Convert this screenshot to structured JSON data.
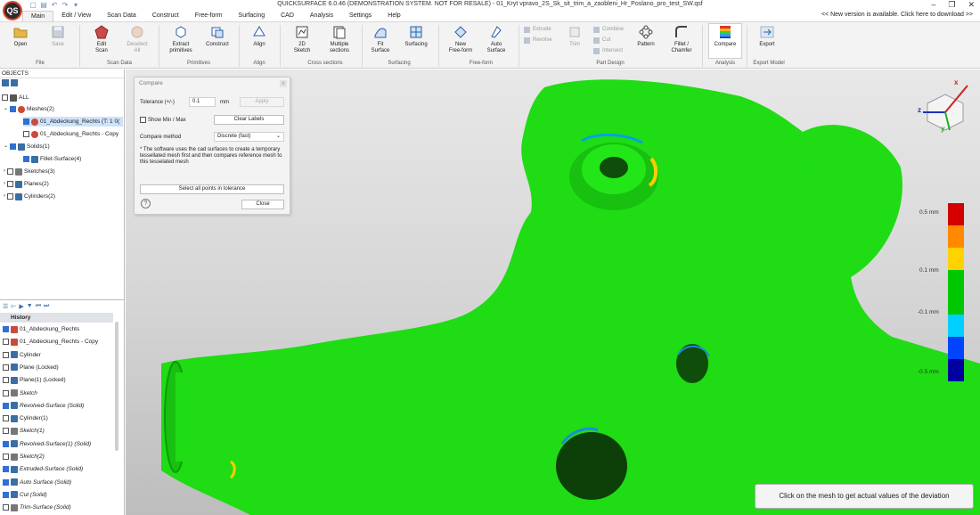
{
  "window": {
    "title": "QUICKSURFACE 6.0.46 (DEMONSTRATION SYSTEM. NOT FOR RESALE) - 01_Kryt vpravo_2S_Sk_sit_trim_a_zaobleni_Hr_Poslano_pro_test_SW.qsf",
    "minimize": "–",
    "maximize": "❐",
    "close": "✕"
  },
  "menu_tabs": [
    "Main",
    "Edit / View",
    "Scan Data",
    "Construct",
    "Free-form",
    "Surfacing",
    "CAD",
    "Analysis",
    "Settings",
    "Help"
  ],
  "update_note": "<< New version is available. Click here to download >>",
  "ribbon": {
    "file": {
      "open": "Open",
      "save": "Save",
      "group": "File"
    },
    "scan_data": {
      "edit_scan": "Edit\nScan",
      "deselect_all": "Deselect\nAll",
      "group": "Scan Data"
    },
    "primitives": {
      "extract": "Extract\nprimitives",
      "construct": "Construct",
      "group": "Primitives"
    },
    "align": {
      "align": "Align",
      "group": "Align"
    },
    "cross_sections": {
      "sketch2d": "2D\nSketch",
      "multiple": "Multiple\nsections",
      "group": "Cross sections"
    },
    "surfacing": {
      "fit_surface": "Fit\nSurface",
      "surfacing": "Surfacing",
      "group": "Surfacing"
    },
    "freeform": {
      "new_freeform": "New\nFree-form",
      "auto_surface": "Auto\nSurface",
      "group": "Free-form"
    },
    "part_design": {
      "extrude": "Extrude",
      "revolve": "Revolve",
      "trim": "Trim",
      "combine": "Combine",
      "cut": "Cut",
      "intersect": "Intersect",
      "pattern": "Pattern",
      "fillet": "Fillet /\nChamfer",
      "group": "Part Design"
    },
    "analysis": {
      "compare": "Compare",
      "group": "Analysis"
    },
    "export": {
      "export": "Export",
      "group": "Export Model"
    }
  },
  "objects_panel": {
    "header": "OBJECTS",
    "tree": [
      {
        "label": "ALL"
      },
      {
        "label": "Meshes(2)"
      },
      {
        "label": "01_Abdeckung_Rechts (T: 1 0("
      },
      {
        "label": "01_Abdeckung_Rechts - Copy"
      },
      {
        "label": "Solids(1)"
      },
      {
        "label": "Fillet-Surface(4)"
      },
      {
        "label": "Sketches(3)"
      },
      {
        "label": "Planes(2)"
      },
      {
        "label": "Cylinders(2)"
      }
    ]
  },
  "history": {
    "header": "History",
    "items": [
      "01_Abdeckung_Rechts",
      "01_Abdeckung_Rechts - Copy",
      "Cylinder",
      "Plane (Locked)",
      "Plane(1) (Locked)",
      "Sketch",
      "Revolved-Surface (Solid)",
      "Cylinder(1)",
      "Sketch(1)",
      "Revolved-Surface(1) (Solid)",
      "Sketch(2)",
      "Extruded-Surface (Solid)",
      "Auto Surface (Solid)",
      "Cut (Solid)",
      "Trim-Surface (Solid)",
      "Fillet-Surface (Solid)"
    ]
  },
  "compare_dialog": {
    "title": "Compare",
    "close_x": "x",
    "tolerance_label": "Tolerance (+/-)",
    "tolerance_value": "0.1",
    "unit": "mm",
    "apply": "Apply",
    "show_minmax": "Show Min / Max",
    "clear_labels": "Clear Labels",
    "method_label": "Compare method",
    "method_value": "Discrete (fast)",
    "note": "* The software uses the cad surfaces to create a temporary tessellated mesh first and then compares reference mesh to this tesselated mesh",
    "select_all": "Select all points in tolerance",
    "help": "?",
    "close": "Close"
  },
  "color_scale": {
    "labels": [
      "0.5 mm",
      "0.1 mm",
      "-0.1 mm",
      "-0.5 mm"
    ],
    "colors": [
      "#d40000",
      "#ff8a00",
      "#ffd200",
      "#00c800",
      "#00c800",
      "#00d0ff",
      "#0044ff",
      "#0000a0"
    ]
  },
  "axes": {
    "x": "x",
    "y": "y",
    "z": "z"
  },
  "hint": "Click on the mesh to get actual values of the deviation"
}
